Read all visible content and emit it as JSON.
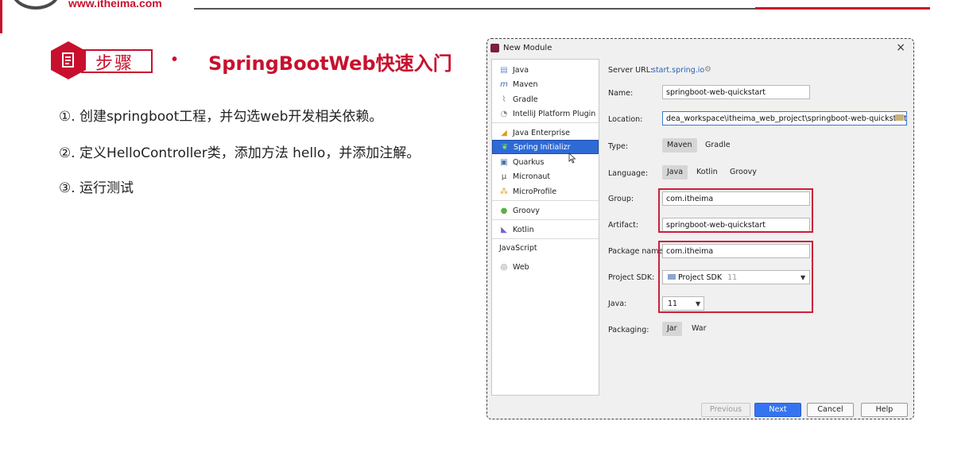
{
  "slide": {
    "logo_url": "www.itheima.com",
    "step_label": "步骤",
    "bullet": "•",
    "title": "SpringBootWeb快速入门",
    "steps": [
      "①. 创建springboot工程，并勾选web开发相关依赖。",
      "②. 定义HelloController类，添加方法 hello，并添加注解。",
      "③. 运行测试"
    ]
  },
  "dialog": {
    "title": "New Module",
    "close": "×",
    "generators": [
      {
        "label": "Java",
        "icon": "java-folder-icon",
        "glyph": "▤"
      },
      {
        "label": "Maven",
        "icon": "maven-icon",
        "glyph": "m"
      },
      {
        "label": "Gradle",
        "icon": "gradle-icon",
        "glyph": "⌇"
      },
      {
        "label": "IntelliJ Platform Plugin",
        "icon": "plugin-icon",
        "glyph": "◔"
      },
      {
        "label": "Java Enterprise",
        "icon": "java-enterprise-icon",
        "glyph": "◢"
      },
      {
        "label": "Spring Initializr",
        "icon": "spring-icon",
        "glyph": "❦"
      },
      {
        "label": "Quarkus",
        "icon": "quarkus-icon",
        "glyph": "▣"
      },
      {
        "label": "Micronaut",
        "icon": "micronaut-icon",
        "glyph": "μ"
      },
      {
        "label": "MicroProfile",
        "icon": "microprofile-icon",
        "glyph": "⁂"
      },
      {
        "label": "Groovy",
        "icon": "groovy-icon",
        "glyph": "●"
      },
      {
        "label": "Kotlin",
        "icon": "kotlin-icon",
        "glyph": "◣"
      },
      {
        "label": "JavaScript",
        "icon": "",
        "glyph": ""
      },
      {
        "label": "Web",
        "icon": "web-globe-icon",
        "glyph": "◎"
      }
    ],
    "selected_generator": "Spring Initializr",
    "form": {
      "server_url_label": "Server URL:",
      "server_url": "start.spring.io",
      "name_label": "Name:",
      "name": "springboot-web-quickstart",
      "location_label": "Location:",
      "location": "dea_workspace\\itheima_web_project\\springboot-web-quickstart",
      "type_label": "Type:",
      "type_options": [
        "Maven",
        "Gradle"
      ],
      "type_selected": "Maven",
      "language_label": "Language:",
      "language_options": [
        "Java",
        "Kotlin",
        "Groovy"
      ],
      "language_selected": "Java",
      "group_label": "Group:",
      "group": "com.itheima",
      "artifact_label": "Artifact:",
      "artifact": "springboot-web-quickstart",
      "package_label": "Package name:",
      "package": "com.itheima",
      "sdk_label": "Project SDK:",
      "sdk": "Project SDK",
      "sdk_version": "11",
      "java_label": "Java:",
      "java": "11",
      "packaging_label": "Packaging:",
      "packaging_options": [
        "Jar",
        "War"
      ],
      "packaging_selected": "Jar"
    },
    "buttons": {
      "previous": "Previous",
      "next": "Next",
      "cancel": "Cancel",
      "help": "Help"
    }
  },
  "colors": {
    "brand_red": "#c8102e",
    "selection_blue": "#2e6ad6",
    "primary_button": "#3574f0"
  }
}
